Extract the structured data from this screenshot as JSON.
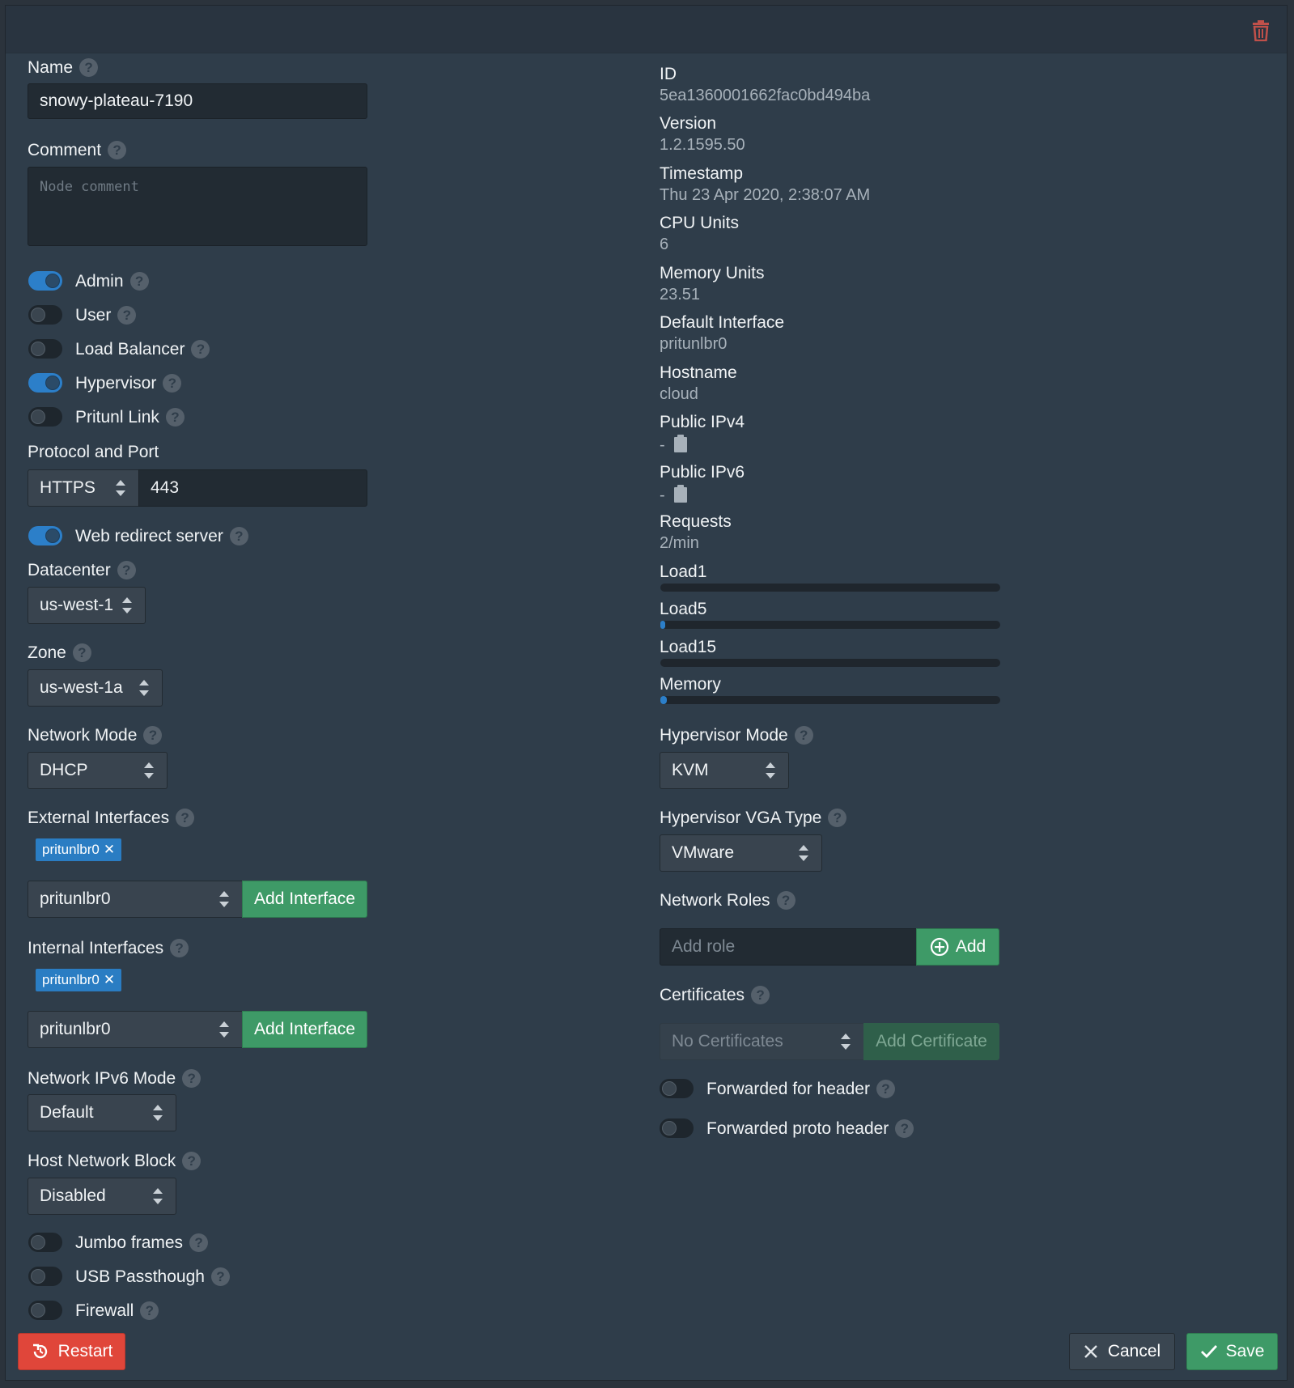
{
  "left": {
    "name_label": "Name",
    "name_value": "snowy-plateau-7190",
    "comment_label": "Comment",
    "comment_placeholder": "Node comment",
    "toggles": [
      {
        "label": "Admin",
        "on": true
      },
      {
        "label": "User",
        "on": false
      },
      {
        "label": "Load Balancer",
        "on": false
      },
      {
        "label": "Hypervisor",
        "on": true
      },
      {
        "label": "Pritunl Link",
        "on": false
      }
    ],
    "protocol_label": "Protocol and Port",
    "protocol_value": "HTTPS",
    "port_value": "443",
    "web_redirect_label": "Web redirect server",
    "web_redirect_on": true,
    "datacenter_label": "Datacenter",
    "datacenter_value": "us-west-1",
    "zone_label": "Zone",
    "zone_value": "us-west-1a",
    "network_mode_label": "Network Mode",
    "network_mode_value": "DHCP",
    "external_label": "External Interfaces",
    "external_tag": "pritunlbr0",
    "external_select": "pritunlbr0",
    "add_interface_label": "Add Interface",
    "internal_label": "Internal Interfaces",
    "internal_tag": "pritunlbr0",
    "internal_select": "pritunlbr0",
    "ipv6_mode_label": "Network IPv6 Mode",
    "ipv6_mode_value": "Default",
    "host_block_label": "Host Network Block",
    "host_block_value": "Disabled",
    "bottom_toggles": [
      {
        "label": "Jumbo frames",
        "on": false
      },
      {
        "label": "USB Passthough",
        "on": false
      },
      {
        "label": "Firewall",
        "on": false
      }
    ]
  },
  "right": {
    "info": [
      {
        "label": "ID",
        "value": "5ea1360001662fac0bd494ba"
      },
      {
        "label": "Version",
        "value": "1.2.1595.50"
      },
      {
        "label": "Timestamp",
        "value": "Thu 23 Apr 2020, 2:38:07 AM"
      },
      {
        "label": "CPU Units",
        "value": "6"
      },
      {
        "label": "Memory Units",
        "value": "23.51"
      },
      {
        "label": "Default Interface",
        "value": "pritunlbr0"
      },
      {
        "label": "Hostname",
        "value": "cloud"
      },
      {
        "label": "Public IPv4",
        "value": "-"
      },
      {
        "label": "Public IPv6",
        "value": "-"
      },
      {
        "label": "Requests",
        "value": "2/min"
      }
    ],
    "load_bars": [
      {
        "label": "Load1",
        "percent": 0
      },
      {
        "label": "Load5",
        "percent": 0.5
      },
      {
        "label": "Load15",
        "percent": 0
      },
      {
        "label": "Memory",
        "percent": 2
      }
    ],
    "hypervisor_mode_label": "Hypervisor Mode",
    "hypervisor_mode_value": "KVM",
    "vga_label": "Hypervisor VGA Type",
    "vga_value": "VMware",
    "network_roles_label": "Network Roles",
    "add_role_placeholder": "Add role",
    "add_role_button": "Add",
    "certificates_label": "Certificates",
    "cert_select": "No Certificates",
    "add_cert_button": "Add Certificate",
    "forwarded_for_label": "Forwarded for header",
    "forwarded_proto_label": "Forwarded proto header"
  },
  "footer": {
    "restart": "Restart",
    "cancel": "Cancel",
    "save": "Save"
  },
  "colors": {
    "accent": "#2c7fc9",
    "success": "#3e9a67",
    "danger": "#e0463a"
  }
}
